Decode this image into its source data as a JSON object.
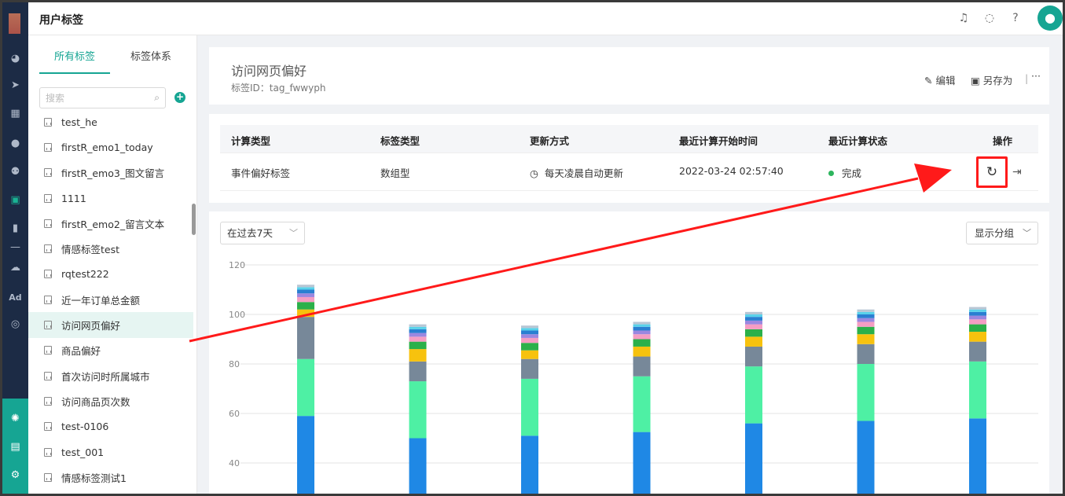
{
  "header": {
    "title": "用户标签"
  },
  "sidebar": {
    "tabs": [
      {
        "label": "所有标签"
      },
      {
        "label": "标签体系"
      }
    ],
    "search_placeholder": "搜索",
    "items": [
      {
        "label": "test_he"
      },
      {
        "label": "firstR_emo1_today"
      },
      {
        "label": "firstR_emo3_图文留言"
      },
      {
        "label": "1111"
      },
      {
        "label": "firstR_emo2_留言文本"
      },
      {
        "label": "情感标签test"
      },
      {
        "label": "rqtest222"
      },
      {
        "label": "近一年订单总金额"
      },
      {
        "label": "访问网页偏好",
        "active": true
      },
      {
        "label": "商品偏好"
      },
      {
        "label": "首次访问时所属城市"
      },
      {
        "label": "访问商品页次数"
      },
      {
        "label": "test-0106"
      },
      {
        "label": "test_001"
      },
      {
        "label": "情感标签测试1"
      }
    ]
  },
  "detail": {
    "title": "访问网页偏好",
    "tag_id_label": "标签ID：",
    "tag_id": "tag_fwwyph",
    "actions": {
      "edit": "编辑",
      "save_as": "另存为",
      "more": "···"
    }
  },
  "table": {
    "headers": [
      "计算类型",
      "标签类型",
      "更新方式",
      "最近计算开始时间",
      "最近计算状态",
      "操作"
    ],
    "row": {
      "calc_type": "事件偏好标签",
      "tag_type": "数组型",
      "update_mode": "每天凌晨自动更新",
      "last_start": "2022-03-24 02:57:40",
      "status": "完成"
    }
  },
  "chart_controls": {
    "range": "在过去7天",
    "group_button": "显示分组"
  },
  "colors": {
    "accent": "#16a593",
    "highlight": "#ff1a1a",
    "status_ok": "#2db55d"
  },
  "chart_data": {
    "type": "bar",
    "stacked": true,
    "yticks": [
      40,
      60,
      80,
      100,
      120
    ],
    "ylim": [
      30,
      122
    ],
    "grid": true,
    "segment_colors": [
      "#1f88e5",
      "#4ef0a4",
      "#778899",
      "#f7c20e",
      "#2bb04a",
      "#f59dc3",
      "#9b87e0",
      "#2a7fd1",
      "#58d2ea",
      "#b8c6d4"
    ],
    "series_values": [
      [
        59,
        23,
        17,
        3,
        3,
        2,
        1.5,
        1.5,
        1,
        1
      ],
      [
        50,
        23,
        8,
        5,
        3,
        2,
        1.5,
        1.5,
        1,
        1
      ],
      [
        51,
        23,
        8,
        3.5,
        3,
        2,
        1.5,
        1.5,
        1,
        1
      ],
      [
        52.5,
        22.5,
        8,
        4,
        3,
        2,
        1.5,
        1.5,
        1,
        1
      ],
      [
        56,
        23,
        8,
        4,
        3,
        2,
        1.5,
        1.5,
        1,
        1
      ],
      [
        57,
        23,
        8,
        4,
        3,
        2,
        1.5,
        1.5,
        1,
        1
      ],
      [
        58,
        23,
        8,
        4,
        3,
        2,
        1.5,
        1.5,
        1,
        1
      ]
    ]
  }
}
